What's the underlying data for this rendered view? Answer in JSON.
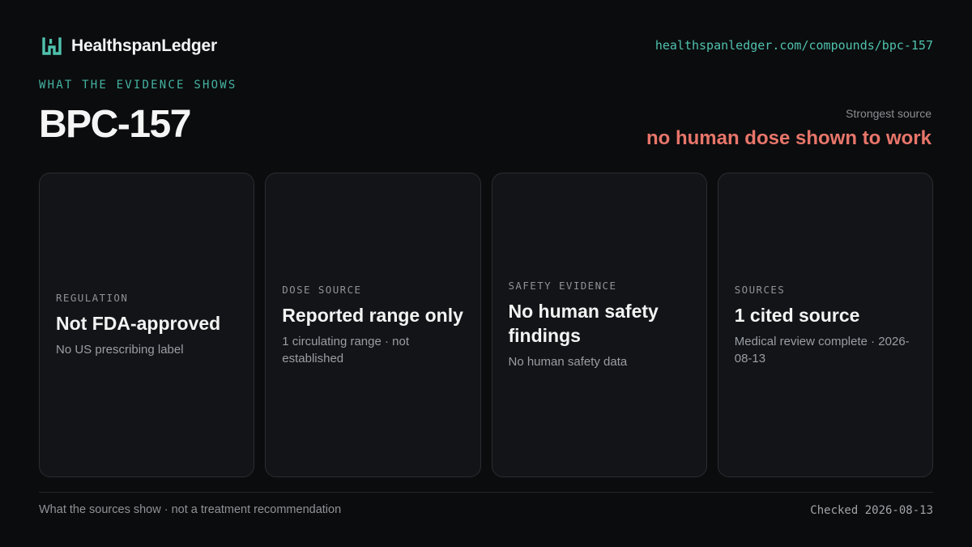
{
  "brand": {
    "name": "HealthspanLedger",
    "logo_icon": "ledger-h-logo-icon",
    "accent_color": "#4fc2ad"
  },
  "header": {
    "url": "healthspanledger.com/compounds/bpc-157"
  },
  "eyebrow": "WHAT THE EVIDENCE SHOWS",
  "compound": {
    "title": "BPC-157"
  },
  "strongest_source": {
    "label": "Strongest source",
    "value": "no human dose shown to work",
    "value_color": "#e8766a"
  },
  "cards": [
    {
      "label": "REGULATION",
      "value": "Not FDA-approved",
      "note": "No US prescribing label"
    },
    {
      "label": "DOSE SOURCE",
      "value": "Reported range only",
      "note": "1 circulating range · not established"
    },
    {
      "label": "SAFETY EVIDENCE",
      "value": "No human safety findings",
      "note": "No human safety data"
    },
    {
      "label": "SOURCES",
      "value": "1 cited source",
      "note": "Medical review complete · 2026-08-13"
    }
  ],
  "footer": {
    "note": "What the sources show · not a treatment recommendation",
    "checked": "Checked 2026-08-13"
  }
}
